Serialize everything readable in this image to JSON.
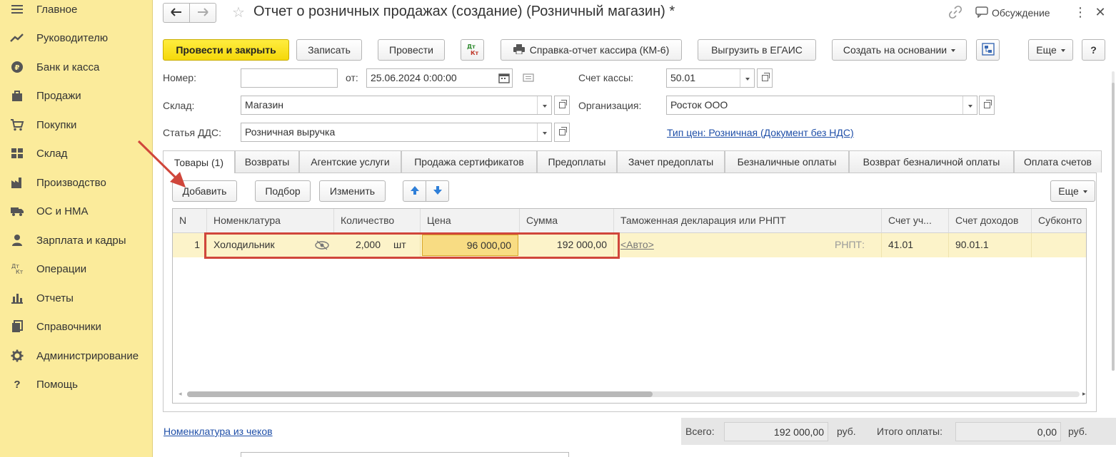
{
  "sidebar": {
    "items": [
      {
        "label": "Главное",
        "icon": "menu-icon"
      },
      {
        "label": "Руководителю",
        "icon": "trend-icon"
      },
      {
        "label": "Банк и касса",
        "icon": "coin-icon"
      },
      {
        "label": "Продажи",
        "icon": "bag-icon"
      },
      {
        "label": "Покупки",
        "icon": "cart-icon"
      },
      {
        "label": "Склад",
        "icon": "warehouse-icon"
      },
      {
        "label": "Производство",
        "icon": "factory-icon"
      },
      {
        "label": "ОС и НМА",
        "icon": "truck-icon"
      },
      {
        "label": "Зарплата и кадры",
        "icon": "person-icon"
      },
      {
        "label": "Операции",
        "icon": "dt-kt-icon"
      },
      {
        "label": "Отчеты",
        "icon": "bar-chart-icon"
      },
      {
        "label": "Справочники",
        "icon": "books-icon"
      },
      {
        "label": "Администрирование",
        "icon": "gear-icon"
      },
      {
        "label": "Помощь",
        "icon": "question-icon"
      }
    ]
  },
  "header": {
    "title": "Отчет о розничных продажах (создание) (Розничный магазин) *",
    "discussion": "Обсуждение"
  },
  "toolbar": {
    "post_close": "Провести и закрыть",
    "save": "Записать",
    "post": "Провести",
    "dtkt": "Дт Кт",
    "cashier_report": "Справка-отчет кассира (КМ-6)",
    "egais": "Выгрузить в ЕГАИС",
    "create_based": "Создать на основании",
    "more": "Еще",
    "help": "?"
  },
  "form": {
    "number_label": "Номер:",
    "number_value": "",
    "date_label": "от:",
    "date_value": "25.06.2024  0:00:00",
    "cash_account_label": "Счет кассы:",
    "cash_account_value": "50.01",
    "warehouse_label": "Склад:",
    "warehouse_value": "Магазин",
    "org_label": "Организация:",
    "org_value": "Росток ООО",
    "dds_label": "Статья ДДС:",
    "dds_value": "Розничная выручка",
    "price_type_link": "Тип цен: Розничная (Документ без НДС)"
  },
  "tabs": [
    "Товары (1)",
    "Возвраты",
    "Агентские услуги",
    "Продажа сертификатов",
    "Предоплаты",
    "Зачет предоплаты",
    "Безналичные оплаты",
    "Возврат безналичной оплаты",
    "Оплата счетов"
  ],
  "table_toolbar": {
    "add": "Добавить",
    "pick": "Подбор",
    "edit": "Изменить",
    "more": "Еще"
  },
  "table": {
    "headers": [
      "N",
      "Номенклатура",
      "Количество",
      "Цена",
      "Сумма",
      "Таможенная декларация или РНПТ",
      "Счет уч...",
      "Счет доходов",
      "Субконто"
    ],
    "rows": [
      {
        "n": "1",
        "item": "Холодильник",
        "qty": "2,000",
        "unit": "шт",
        "price": "96 000,00",
        "sum": "192 000,00",
        "customs": "<Авто>",
        "rnpt": "РНПТ:",
        "account": "41.01",
        "income_account": "90.01.1",
        "subconto": ""
      }
    ]
  },
  "footer": {
    "nomenclature_link": "Номенклатура из чеков",
    "total_label": "Всего:",
    "total_value": "192 000,00",
    "currency1": "руб.",
    "paid_label": "Итого оплаты:",
    "paid_value": "0,00",
    "currency2": "руб."
  },
  "colors": {
    "sidebar_bg": "#fbeb9b",
    "primary_button": "#f5d80a",
    "selected_row": "#fcf3c9",
    "highlight_frame": "#d0463b"
  }
}
